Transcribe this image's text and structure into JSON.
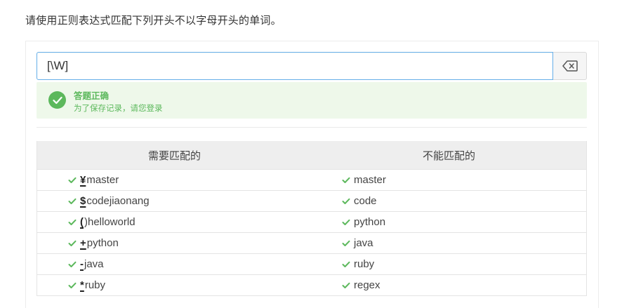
{
  "question": "请使用正则表达式匹配下列开头不以字母开头的单词。",
  "regex_input": {
    "value": "[\\W]"
  },
  "result": {
    "title": "答题正确",
    "subtitle": "为了保存记录，请您登录"
  },
  "table": {
    "headers": {
      "match": "需要匹配的",
      "no_match": "不能匹配的"
    },
    "rows": [
      {
        "match_hl": "¥",
        "match_rest": "master",
        "no_match": "master"
      },
      {
        "match_hl": "$",
        "match_rest": "codejiaonang",
        "no_match": "code"
      },
      {
        "match_hl": "(",
        "match_rest": ")helloworld",
        "no_match": "python"
      },
      {
        "match_hl": "+",
        "match_rest": "python",
        "no_match": "java"
      },
      {
        "match_hl": "-",
        "match_rest": "java",
        "no_match": "ruby"
      },
      {
        "match_hl": "*",
        "match_rest": "ruby",
        "no_match": "regex"
      }
    ]
  },
  "colors": {
    "success": "#5cb85c",
    "focus_border": "#66afe9"
  }
}
